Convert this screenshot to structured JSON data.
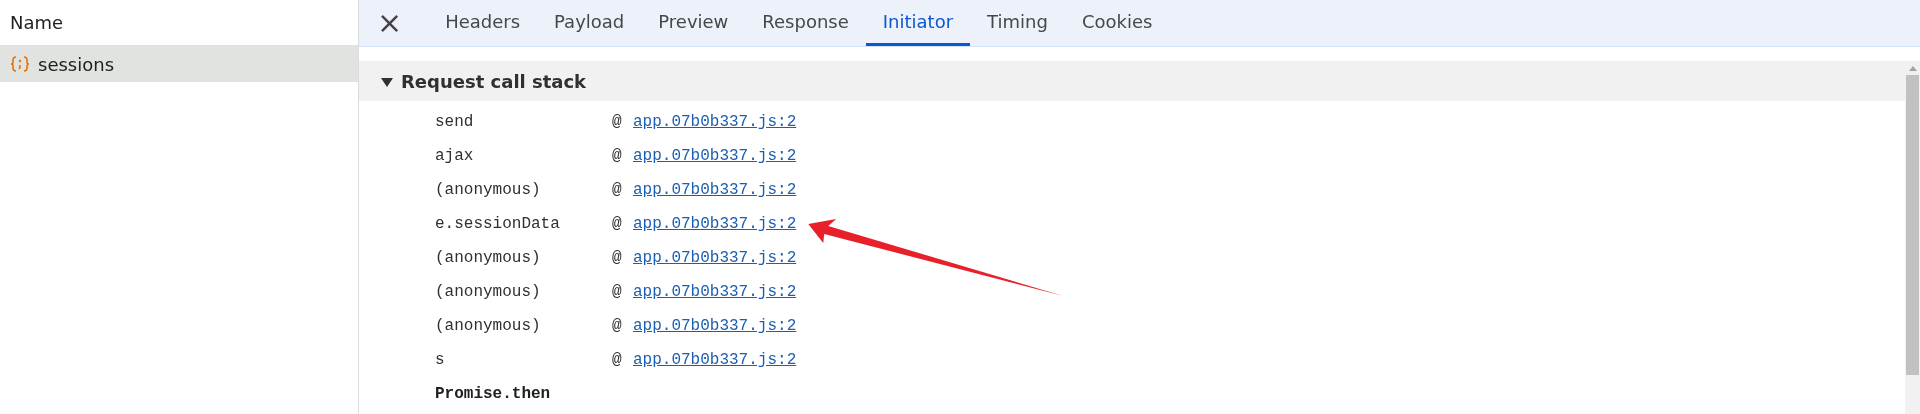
{
  "requests": {
    "header": "Name",
    "items": [
      {
        "name": "sessions",
        "selected": true
      }
    ]
  },
  "detail": {
    "close": "×",
    "tabs": [
      {
        "label": "Headers",
        "selected": false
      },
      {
        "label": "Payload",
        "selected": false
      },
      {
        "label": "Preview",
        "selected": false
      },
      {
        "label": "Response",
        "selected": false
      },
      {
        "label": "Initiator",
        "selected": true
      },
      {
        "label": "Timing",
        "selected": false
      },
      {
        "label": "Cookies",
        "selected": false
      }
    ],
    "section": {
      "title": "Request call stack",
      "expanded": true,
      "frames": [
        {
          "function": "send",
          "at": "@",
          "link": "app.07b0b337.js:2"
        },
        {
          "function": "ajax",
          "at": "@",
          "link": "app.07b0b337.js:2"
        },
        {
          "function": "(anonymous)",
          "at": "@",
          "link": "app.07b0b337.js:2"
        },
        {
          "function": "e.sessionData",
          "at": "@",
          "link": "app.07b0b337.js:2",
          "annotated": true
        },
        {
          "function": "(anonymous)",
          "at": "@",
          "link": "app.07b0b337.js:2"
        },
        {
          "function": "(anonymous)",
          "at": "@",
          "link": "app.07b0b337.js:2"
        },
        {
          "function": "(anonymous)",
          "at": "@",
          "link": "app.07b0b337.js:2"
        },
        {
          "function": "s",
          "at": "@",
          "link": "app.07b0b337.js:2"
        }
      ],
      "async_label": "Promise.then"
    }
  }
}
